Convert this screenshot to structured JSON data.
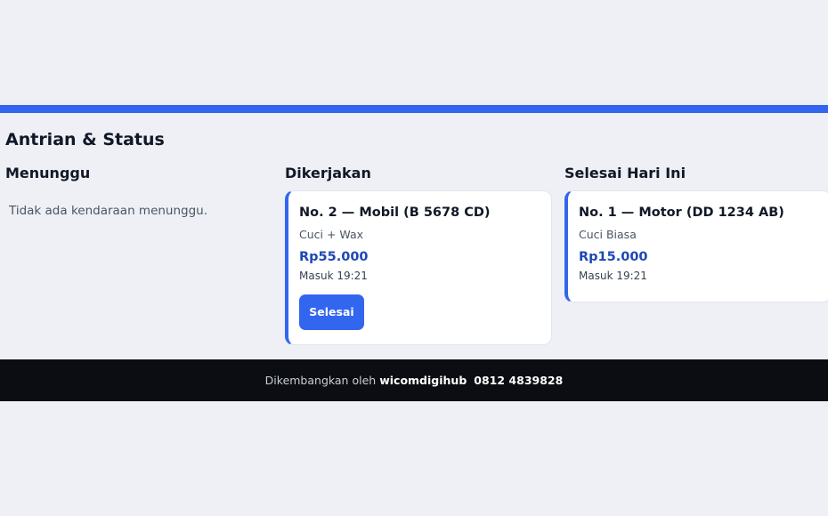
{
  "page": {
    "section_title": "Antrian & Status",
    "accent_color": "#3366ee"
  },
  "columns": {
    "waiting": {
      "title": "Menunggu",
      "empty_text": "Tidak ada kendaraan menunggu."
    },
    "working": {
      "title": "Dikerjakan",
      "cards": [
        {
          "title": "No. 2 — Mobil (B 5678 CD)",
          "service": "Cuci + Wax",
          "price": "Rp55.000",
          "time": "Masuk 19:21",
          "button_label": "Selesai"
        }
      ]
    },
    "done": {
      "title": "Selesai Hari Ini",
      "cards": [
        {
          "title": "No. 1 — Motor (DD 1234 AB)",
          "service": "Cuci Biasa",
          "price": "Rp15.000",
          "time": "Masuk 19:21"
        }
      ]
    }
  },
  "footer": {
    "prefix": "Dikembangkan oleh",
    "brand": "wicomdigihub",
    "phone": "0812 4839828"
  }
}
